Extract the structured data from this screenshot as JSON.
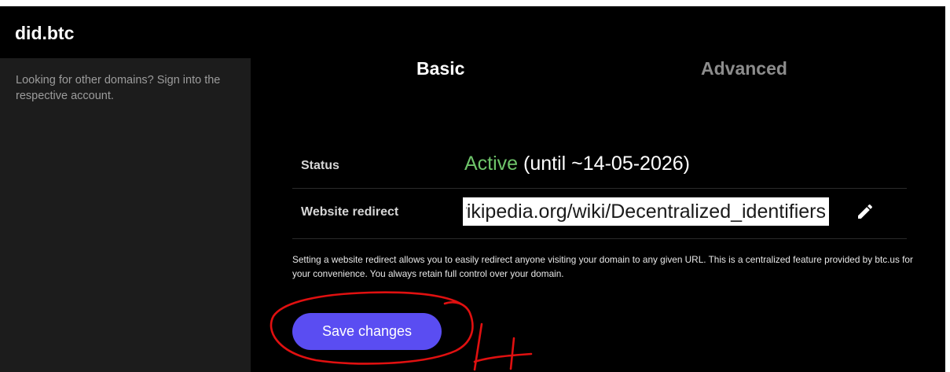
{
  "header": {
    "domain": "did.btc"
  },
  "sidebar": {
    "note": "Looking for other domains? Sign into the respective account."
  },
  "tabs": [
    {
      "label": "Basic",
      "active": true
    },
    {
      "label": "Advanced",
      "active": false
    }
  ],
  "status": {
    "label": "Status",
    "state": "Active",
    "until": "(until ~14-05-2026)"
  },
  "redirect": {
    "label": "Website redirect",
    "value": "https://en.wikipedia.org/wiki/Decentralized_identifiers",
    "edit_icon": "pencil-icon"
  },
  "help_text": "Setting a website redirect allows you to easily redirect anyone visiting your domain to any given URL. This is a centralized feature provided by btc.us for your convenience. You always retain full control over your domain.",
  "actions": {
    "save_label": "Save changes"
  },
  "annotation": {
    "number": "4",
    "color": "#e01010"
  },
  "colors": {
    "accent": "#5a4df2",
    "active_status": "#6ec46a",
    "background": "#000000",
    "sidebar": "#1c1c1c"
  }
}
